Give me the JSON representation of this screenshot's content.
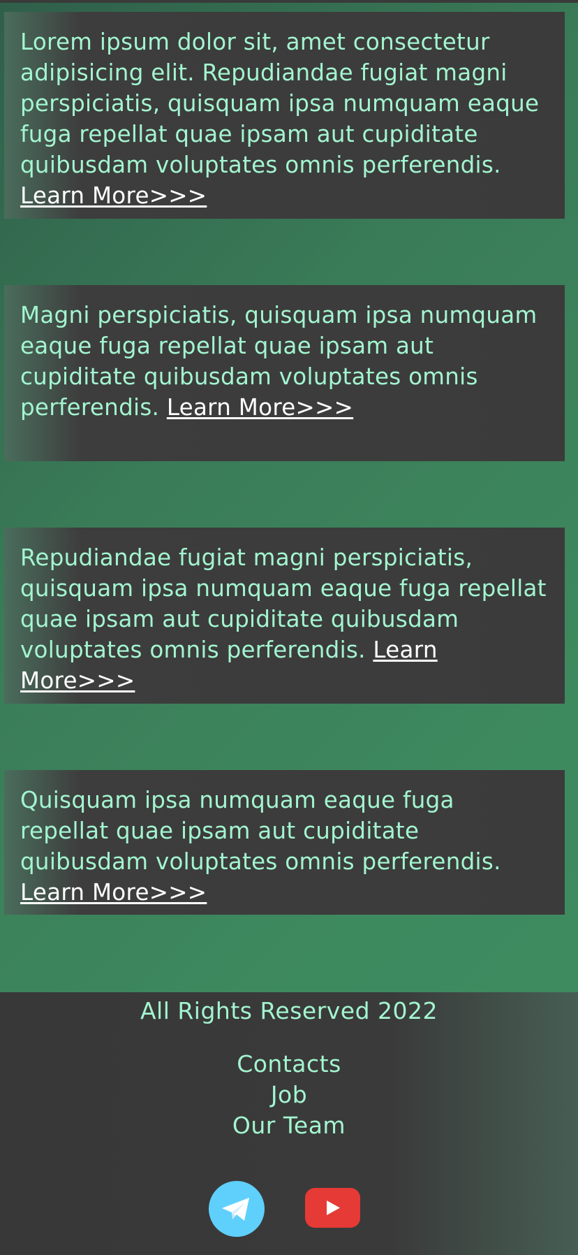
{
  "cards": [
    {
      "text": "Lorem ipsum dolor sit, amet consectetur adipisicing elit. Repudiandae fugiat magni perspiciatis, quisquam ipsa numquam eaque fuga repellat quae ipsam aut cupiditate quibusdam voluptates omnis perferendis.",
      "link": "Learn More>>>"
    },
    {
      "text": "Magni perspiciatis, quisquam ipsa numquam eaque fuga repellat quae ipsam aut cupiditate quibusdam voluptates omnis perferendis.",
      "link": "Learn More>>>"
    },
    {
      "text": "Repudiandae fugiat magni perspiciatis, quisquam ipsa numquam eaque fuga repellat quae ipsam aut cupiditate quibusdam voluptates omnis perferendis.",
      "link": "Learn More>>>"
    },
    {
      "text": "Quisquam ipsa numquam eaque fuga repellat quae ipsam aut cupiditate quibusdam voluptates omnis perferendis.",
      "link": "Learn More>>>"
    }
  ],
  "footer": {
    "copyright": "All Rights Reserved 2022",
    "links": [
      "Contacts",
      "Job",
      "Our Team"
    ],
    "social": [
      {
        "icon": "telegram-icon",
        "color": "#5fd0fb"
      },
      {
        "icon": "youtube-icon",
        "color": "#e53a35"
      }
    ]
  },
  "colors": {
    "text": "#a3f5cf",
    "link": "#ffffff",
    "card_bg": "#3b3b3b",
    "page_bg": "#3e8a5f"
  }
}
